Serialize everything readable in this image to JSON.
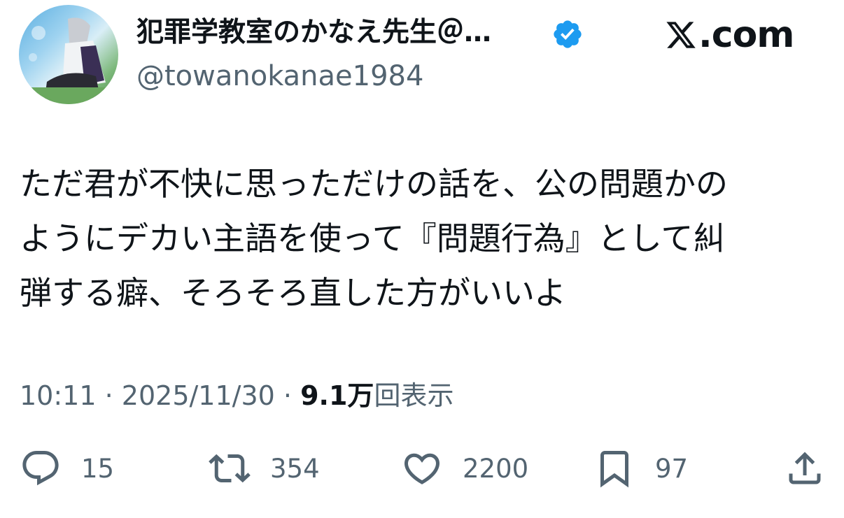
{
  "author": {
    "display_name": "犯罪学教室のかなえ先生＠…",
    "handle": "@towanokanae1984",
    "verified_color": "#1d9bf0"
  },
  "brand": {
    "text": ".com",
    "icon": "x-logo-icon"
  },
  "tweet": {
    "lines": [
      "ただ君が不快に思っただけの話を、公の問題かの",
      "ようにデカい主語を使って『問題行為』として糾",
      "弾する癖、そろそろ直した方がいいよ"
    ]
  },
  "meta": {
    "time": "10:11",
    "separator": "·",
    "date": "2025/11/30",
    "views_count": "9.1万",
    "views_label": "回表示"
  },
  "actions": {
    "replies": "15",
    "reposts": "354",
    "likes": "2200",
    "bookmarks": "97"
  },
  "colors": {
    "text": "#0f1419",
    "muted": "#536471",
    "accent": "#1d9bf0"
  }
}
